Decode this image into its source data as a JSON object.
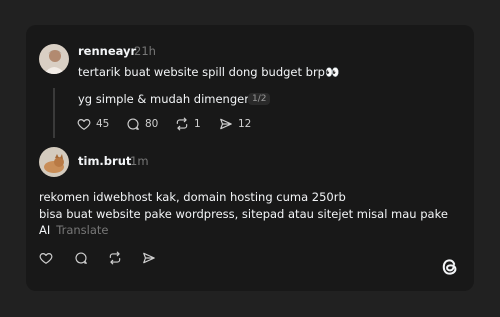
{
  "post": {
    "username": "renneayr",
    "time": "21h",
    "text": "tertarik buat website spill dong budget brp👀",
    "reply_text": "yg simple & mudah dimengerti",
    "counter": "1/2",
    "likes": "45",
    "replies": "80",
    "reposts": "1",
    "shares": "12"
  },
  "reply": {
    "username": "tim.brut",
    "time": "1m",
    "line1": "rekomen idwebhost kak, domain hosting cuma 250rb",
    "line2": "bisa buat website pake wordpress, sitepad atau sitejet misal mau pake",
    "line3": "AI",
    "translate": "Translate"
  },
  "icons": {
    "like": "heart-icon",
    "reply": "comment-icon",
    "repost": "repost-icon",
    "share": "send-icon",
    "brand": "threads-logo-icon"
  }
}
